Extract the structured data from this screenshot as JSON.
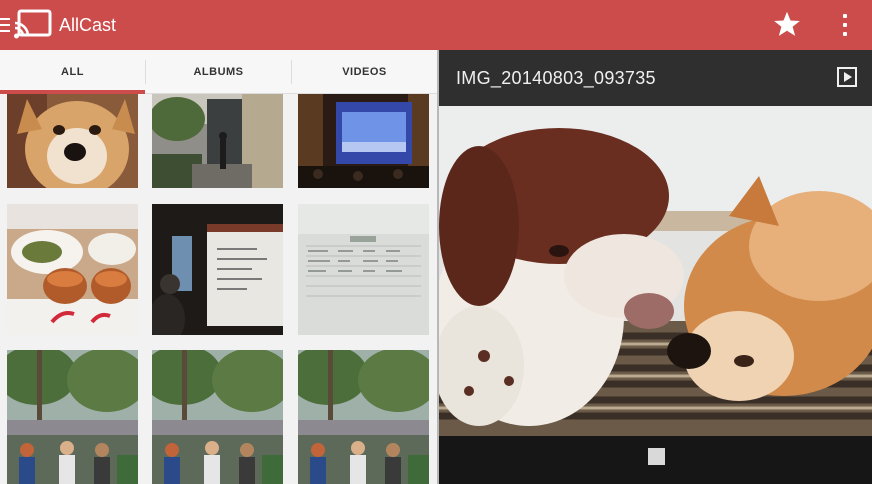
{
  "app": {
    "title": "AllCast",
    "accent_color": "#cc4b4b"
  },
  "toolbar": {
    "menu_icon": "menu-icon",
    "logo_icon": "cast-icon",
    "favorite_icon": "star-icon",
    "overflow_icon": "overflow-menu-icon"
  },
  "tabs": [
    {
      "label": "ALL",
      "selected": true
    },
    {
      "label": "ALBUMS",
      "selected": false
    },
    {
      "label": "VIDEOS",
      "selected": false
    }
  ],
  "gallery": {
    "thumbnails": [
      "dog-portrait",
      "city-street",
      "theater-stage",
      "food-plate",
      "whiteboard-presentation",
      "spreadsheet-screen",
      "street-crowd",
      "street-crowd",
      "street-crowd"
    ]
  },
  "viewer": {
    "title": "IMG_20140803_093735",
    "play_icon": "play-icon",
    "stop_icon": "stop-icon"
  }
}
